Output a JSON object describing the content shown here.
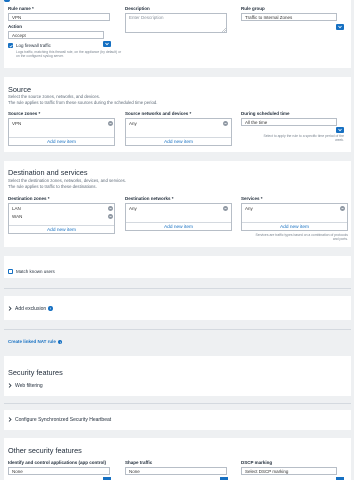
{
  "rule": {
    "rule_name_label": "Rule name *",
    "rule_name_value": "VPN",
    "description_label": "Description",
    "description_placeholder": "Enter Description",
    "rule_group_label": "Rule group",
    "rule_group_value": "Traffic to Internal Zones",
    "action_label": "Action",
    "action_value": "Accept",
    "log_firewall_label": "Log firewall traffic",
    "log_firewall_help": "Logs traffic, matching this firewall rule, on the appliance (by default) or on the configured syslog server."
  },
  "source": {
    "title": "Source",
    "desc1": "Select the source zones, networks, and devices.",
    "desc2": "The rule applies to traffic from these sources during the scheduled time period.",
    "zones_label": "Source zones *",
    "zones": [
      "VPN"
    ],
    "networks_label": "Source networks and devices *",
    "networks": [
      "Any"
    ],
    "schedule_label": "During scheduled time",
    "schedule_value": "All the time",
    "schedule_help": "Select to apply the rule to a specific time period of the week.",
    "add_new": "Add new item"
  },
  "destination": {
    "title": "Destination and services",
    "desc1": "Select the destination zones, networks, devices, and services.",
    "desc2": "The rule applies to traffic to these destinations.",
    "zones_label": "Destination zones *",
    "zones": [
      "LAN",
      "WAN"
    ],
    "networks_label": "Destination networks *",
    "networks": [
      "Any"
    ],
    "services_label": "Services *",
    "services": [
      "Any"
    ],
    "services_help": "Services are traffic types based on a combination of protocols and ports.",
    "add_new": "Add new item"
  },
  "match_known_users": "Match known users",
  "add_exclusion": "Add exclusion",
  "create_nat_rule": "Create linked NAT rule",
  "security_features": {
    "title": "Security features",
    "web_filtering": "Web filtering"
  },
  "heartbeat": "Configure Synchronized Security Heartbeat",
  "other_security": {
    "title": "Other security features",
    "identify_label": "Identify and control applications (app control)",
    "identify_value": "None",
    "shape_label": "Shape traffic",
    "shape_value": "None",
    "dscp_label": "DSCP marking",
    "dscp_value": "Select DSCP marking"
  },
  "colors": {
    "accent": "#1670c2",
    "background": "#eef0f2",
    "card": "#ffffff",
    "border": "#b7bec7"
  },
  "icons": [
    "chevron-down-icon",
    "remove-item-icon",
    "chevron-right-icon",
    "info-icon",
    "checkmark-icon"
  ]
}
